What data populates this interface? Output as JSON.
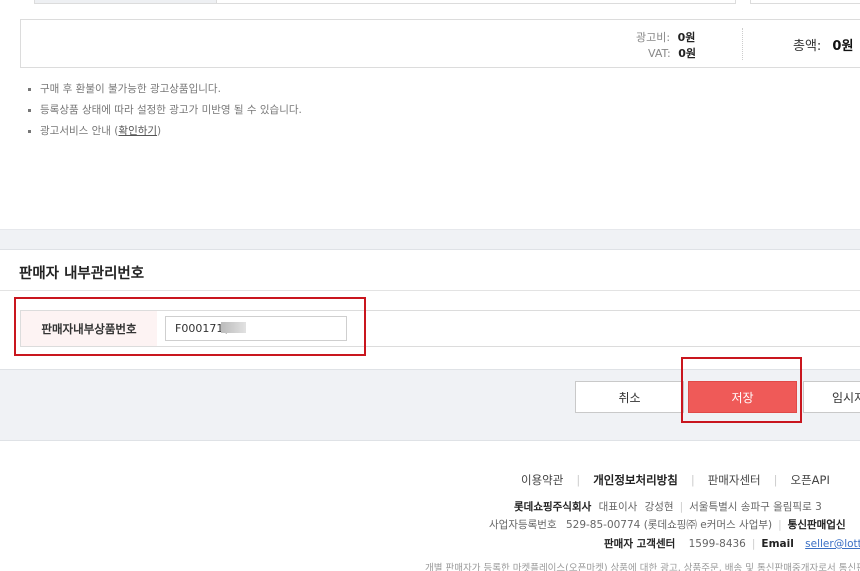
{
  "price": {
    "ad_fee_label": "광고비:",
    "ad_fee_value": "0원",
    "vat_label": "VAT:",
    "vat_value": "0원",
    "total_label": "총액:",
    "total_value": "0원"
  },
  "notes": [
    "구매 후 환불이 불가능한 광고상품입니다.",
    "등록상품 상태에 따라 설정한 광고가 미반영 될 수 있습니다.",
    "광고서비스 안내 ("
  ],
  "notes_link": "확인하기",
  "notes_link_suffix": ")",
  "section": {
    "title": "판매자 내부관리번호",
    "field_label": "판매자내부상품번호",
    "field_value": "F000171("
  },
  "buttons": {
    "cancel": "취소",
    "save": "저장",
    "temp": "임시저"
  },
  "footer": {
    "links": [
      "이용약관",
      "개인정보처리방침",
      "판매자센터",
      "오픈API"
    ],
    "company": "롯데쇼핑주식회사",
    "ceo_label": "대표이사",
    "ceo_name": "강성현",
    "address": "서울특별시 송파구 올림픽로 3",
    "biz_label": "사업자등록번호",
    "biz_number": "529-85-00774 (롯데쇼핑㈜ e커머스 사업부)",
    "mail_order_label": "통신판매업신",
    "cs_label": "판매자 고객센터",
    "cs_phone": "1599-8436",
    "email_label": "Email",
    "email_value": "seller@lotte",
    "disclaimer": "개별 판매자가 등록한 마켓플레이스(오픈마켓) 상품에 대한 광고, 상품주문, 배송 및 통신판매중개자로서 통신판"
  },
  "colors": {
    "accent": "#ef5a58",
    "highlight": "#c9161e",
    "band": "#f0f2f5",
    "label_bg": "#fdf3f3"
  }
}
